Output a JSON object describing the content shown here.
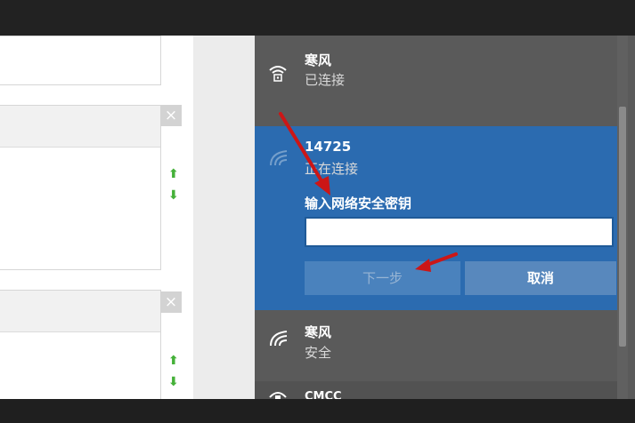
{
  "networks": [
    {
      "name": "寒风",
      "status": "已连接",
      "icon": "wifi-lock-icon"
    },
    {
      "name": "14725",
      "status": "正在连接",
      "icon": "wifi-icon"
    },
    {
      "name": "寒风",
      "status": "安全",
      "icon": "wifi-icon"
    },
    {
      "name": "CMCC",
      "icon": "wifi-lock-icon"
    }
  ],
  "connect": {
    "key_label": "输入网络安全密钥",
    "key_value": "",
    "next_label": "下一步",
    "cancel_label": "取消"
  },
  "left": {
    "close_symbol": "×",
    "up_symbol": "⬆",
    "down_symbol": "⬇"
  },
  "colors": {
    "panel_bg": "#5a5a5a",
    "selected_bg": "#2b6bb0",
    "annotation_arrow": "#cc1616",
    "move_arrow": "#45b139"
  }
}
